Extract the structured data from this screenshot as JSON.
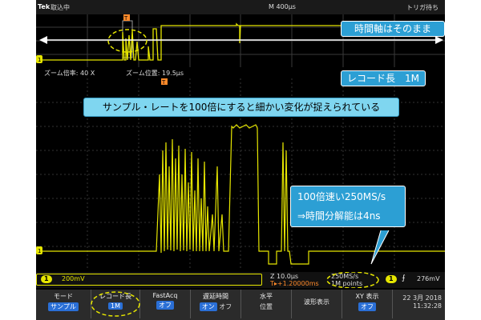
{
  "status_bar": {
    "brand": "Tek",
    "acq_state": "取込中",
    "horizontal_scale": "M 400µs",
    "trigger_state": "トリガ待ち"
  },
  "zoom_info": {
    "zoom_factor": "ズーム倍率: 40 X",
    "zoom_position": "ズーム位置: 19.5µs"
  },
  "markers": {
    "trigger_marker": "T",
    "ch1_marker": "1"
  },
  "readout": {
    "ch1_badge": "1",
    "ch1_volts": "200mV",
    "zoom_scale": "Z 10.0µs",
    "trigger_position": "T▸+1.20000ms",
    "sample_rate": "250MS/s",
    "record_length": "1M points",
    "trigger_badge": "1",
    "trigger_slope": "⨍",
    "trigger_level": "276mV"
  },
  "menu": [
    {
      "label": "モード",
      "value": "サンプル",
      "value_style": "on"
    },
    {
      "label": "レコード長",
      "value": "1M",
      "value_style": "on"
    },
    {
      "label": "FastAcq",
      "value": "オフ",
      "value_style": "on"
    },
    {
      "label": "遅延時間",
      "value": "オン",
      "value2": "オフ",
      "value_style": "on"
    },
    {
      "label": "水平",
      "value": "位置",
      "value_style": "plain"
    },
    {
      "label": "波形表示",
      "value": "",
      "value_style": "plain"
    },
    {
      "label": "XY 表示",
      "value": "オフ",
      "value_style": "on"
    }
  ],
  "clock": {
    "date": "22 3月 2018",
    "time": "11:32:28"
  },
  "callouts": {
    "time_axis": "時間軸はそのまま",
    "record_length": "レコード長　1M",
    "sample_rate_note": "サンプル・レートを100倍にすると細かい変化が捉えられている",
    "speed_line1": "100倍速い250MS/s",
    "speed_line2": "⇒時間分解能は4ns"
  },
  "colors": {
    "trace": "#e6e600",
    "callout_blue": "#2c9fd4",
    "callout_light": "#7fd6f0",
    "highlight_ellipse": "#e6e600",
    "trigger_marker": "#ff8a2a"
  }
}
